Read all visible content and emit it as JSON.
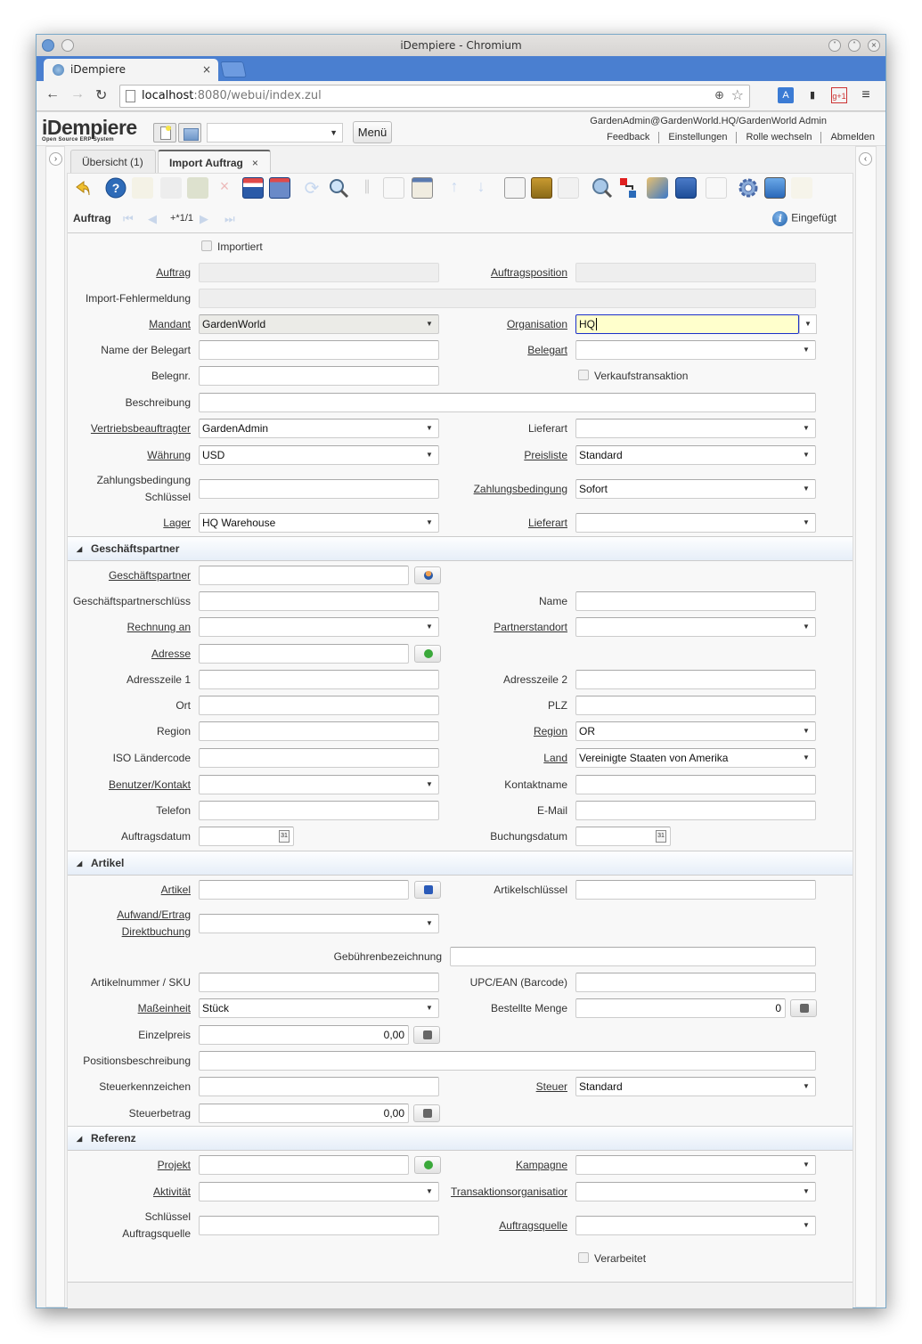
{
  "browser": {
    "window_title": "iDempiere - Chromium",
    "tab_title": "iDempiere",
    "url_host": "localhost",
    "url_rest": ":8080/webui/index.zul"
  },
  "header": {
    "logo": "iDempiere",
    "logo_sub": "Open Source ERP System",
    "search_value": "",
    "menu_label": "Menü",
    "user_info": "GardenAdmin@GardenWorld.HQ/GardenWorld Admin",
    "links": [
      "Feedback",
      "Einstellungen",
      "Rolle wechseln",
      "Abmelden"
    ]
  },
  "window_tabs": [
    {
      "label": "Übersicht (1)",
      "active": false
    },
    {
      "label": "Import Auftrag",
      "active": true,
      "close": "×"
    }
  ],
  "toolbar": {
    "icons": [
      "undo-icon",
      "help-icon",
      "new-record-icon",
      "copy-record-icon",
      "delete-icon",
      "delete-selection-icon",
      "save-icon",
      "save-create-icon",
      "refresh-icon",
      "find-icon",
      "attachment-icon",
      "chat-icon",
      "grid-toggle-icon",
      "parent-record-icon",
      "detail-record-icon",
      "report-icon",
      "archive-icon",
      "print-icon",
      "zoom-across-icon",
      "active-workflows-icon",
      "requests-icon",
      "product-info-icon",
      "post-icon",
      "process-icon",
      "export-icon",
      "import-icon"
    ]
  },
  "record_bar": {
    "tab_name": "Auftrag",
    "record_count": "+*1/1",
    "status": "Eingefügt"
  },
  "form": {
    "importiert": {
      "label": "Importiert",
      "checked": false
    },
    "auftrag": {
      "label": "Auftrag",
      "value": ""
    },
    "auftragsposition": {
      "label": "Auftragsposition",
      "value": ""
    },
    "fehlermeldung": {
      "label": "Import-Fehlermeldung",
      "value": ""
    },
    "mandant": {
      "label": "Mandant",
      "value": "GardenWorld"
    },
    "organisation": {
      "label": "Organisation",
      "value": "HQ"
    },
    "name_belegart": {
      "label": "Name der Belegart",
      "value": ""
    },
    "belegart": {
      "label": "Belegart",
      "value": ""
    },
    "belegnr": {
      "label": "Belegnr.",
      "value": ""
    },
    "verkaufstransaktion": {
      "label": "Verkaufstransaktion",
      "checked": false
    },
    "beschreibung": {
      "label": "Beschreibung",
      "value": ""
    },
    "vertriebsbeauftragter": {
      "label": "Vertriebsbeauftragter",
      "value": "GardenAdmin"
    },
    "lieferart1": {
      "label": "Lieferart",
      "value": ""
    },
    "waehrung": {
      "label": "Währung",
      "value": "USD"
    },
    "preisliste": {
      "label": "Preisliste",
      "value": "Standard"
    },
    "zb_schluessel": {
      "label1": "Zahlungsbedingung",
      "label2": "Schlüssel",
      "value": ""
    },
    "zahlungsbedingung": {
      "label": "Zahlungsbedingung",
      "value": "Sofort"
    },
    "lager": {
      "label": "Lager",
      "value": "HQ Warehouse"
    },
    "lieferart2": {
      "label": "Lieferart",
      "value": ""
    }
  },
  "groups": {
    "gp": "Geschäftspartner",
    "artikel": "Artikel",
    "referenz": "Referenz"
  },
  "gp": {
    "geschaeftspartner": {
      "label": "Geschäftspartner",
      "value": ""
    },
    "gp_schluessel": {
      "label": "Geschäftspartnerschlüss",
      "value": ""
    },
    "name": {
      "label": "Name",
      "value": ""
    },
    "rechnung_an": {
      "label": "Rechnung an",
      "value": ""
    },
    "partnerstandort": {
      "label": "Partnerstandort",
      "value": ""
    },
    "adresse": {
      "label": "Adresse",
      "value": ""
    },
    "adresszeile1": {
      "label": "Adresszeile 1",
      "value": ""
    },
    "adresszeile2": {
      "label": "Adresszeile 2",
      "value": ""
    },
    "ort": {
      "label": "Ort",
      "value": ""
    },
    "plz": {
      "label": "PLZ",
      "value": ""
    },
    "region_text": {
      "label": "Region",
      "value": ""
    },
    "region": {
      "label": "Region",
      "value": "OR"
    },
    "iso": {
      "label": "ISO Ländercode",
      "value": ""
    },
    "land": {
      "label": "Land",
      "value": "Vereinigte Staaten von Amerika"
    },
    "kontakt": {
      "label": "Benutzer/Kontakt",
      "value": ""
    },
    "kontaktname": {
      "label": "Kontaktname",
      "value": ""
    },
    "telefon": {
      "label": "Telefon",
      "value": ""
    },
    "email": {
      "label": "E-Mail",
      "value": ""
    },
    "auftragsdatum": {
      "label": "Auftragsdatum",
      "value": ""
    },
    "buchungsdatum": {
      "label": "Buchungsdatum",
      "value": ""
    }
  },
  "art": {
    "artikel": {
      "label": "Artikel",
      "value": ""
    },
    "artikelschluessel": {
      "label": "Artikelschlüssel",
      "value": ""
    },
    "aufwand": {
      "label1": "Aufwand/Ertrag",
      "label2": "Direktbuchung",
      "value": ""
    },
    "gebuehren": {
      "label": "Gebührenbezeichnung",
      "value": ""
    },
    "sku": {
      "label": "Artikelnummer / SKU",
      "value": ""
    },
    "upc": {
      "label": "UPC/EAN (Barcode)",
      "value": ""
    },
    "masseinheit": {
      "label": "Maßeinheit",
      "value": "Stück"
    },
    "menge": {
      "label": "Bestellte Menge",
      "value": "0"
    },
    "einzelpreis": {
      "label": "Einzelpreis",
      "value": "0,00"
    },
    "posbeschreibung": {
      "label": "Positionsbeschreibung",
      "value": ""
    },
    "steuerkennzeichen": {
      "label": "Steuerkennzeichen",
      "value": ""
    },
    "steuer": {
      "label": "Steuer",
      "value": "Standard"
    },
    "steuerbetrag": {
      "label": "Steuerbetrag",
      "value": "0,00"
    }
  },
  "ref": {
    "projekt": {
      "label": "Projekt",
      "value": ""
    },
    "kampagne": {
      "label": "Kampagne",
      "value": ""
    },
    "aktivitaet": {
      "label": "Aktivität",
      "value": ""
    },
    "transorg": {
      "label": "Transaktionsorganisatior",
      "value": ""
    },
    "quelle_schluessel": {
      "label1": "Schlüssel",
      "label2": "Auftragsquelle",
      "value": ""
    },
    "auftragsquelle": {
      "label": "Auftragsquelle",
      "value": ""
    },
    "verarbeitet": {
      "label": "Verarbeitet",
      "checked": false
    }
  }
}
